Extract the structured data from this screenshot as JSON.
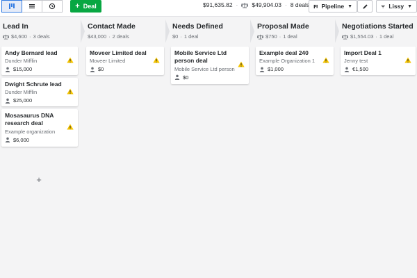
{
  "toolbar": {
    "views": [
      "pipeline-view",
      "list-view",
      "forecast-view"
    ],
    "deal_button": "Deal",
    "total_value": "$91,635.82",
    "weighted_value": "$49,904.03",
    "deal_count": "8 deals",
    "pipeline_label": "Pipeline",
    "filter_label": "Lissy"
  },
  "colors": {
    "accent": "#08a742",
    "active_view": "#317ae2",
    "warning": "#f5c400"
  },
  "stages": [
    {
      "title": "Lead In",
      "value": "$4,600",
      "deals": "3 deals",
      "cards": [
        {
          "title": "Andy Bernard lead",
          "org": "Dunder Mifflin",
          "value": "$15,000"
        },
        {
          "title": "Dwight Schrute lead",
          "org": "Dunder Mifflin",
          "value": "$25,000"
        },
        {
          "title": "Mosasaurus DNA research deal",
          "org": "Example organization",
          "value": "$6,000"
        }
      ]
    },
    {
      "title": "Contact Made",
      "value": "$43,000",
      "deals": "2 deals",
      "cards": [
        {
          "title": "Moveer Limited deal",
          "org": "Moveer Limited",
          "value": "$0"
        }
      ]
    },
    {
      "title": "Needs Defined",
      "value": "$0",
      "deals": "1 deal",
      "cards": [
        {
          "title": "Mobile Service Ltd person deal",
          "org": "Mobile Service Ltd person",
          "value": "$0"
        }
      ]
    },
    {
      "title": "Proposal Made",
      "value": "$750",
      "deals": "1 deal",
      "cards": [
        {
          "title": "Example deal 240",
          "org": "Example Organization 1",
          "value": "$1,000"
        }
      ]
    },
    {
      "title": "Negotiations Started",
      "value": "$1,554.03",
      "deals": "1 deal",
      "cards": [
        {
          "title": "Import Deal 1",
          "org": "Jenny test",
          "value": "€1,500"
        }
      ]
    }
  ],
  "add_label": "+"
}
